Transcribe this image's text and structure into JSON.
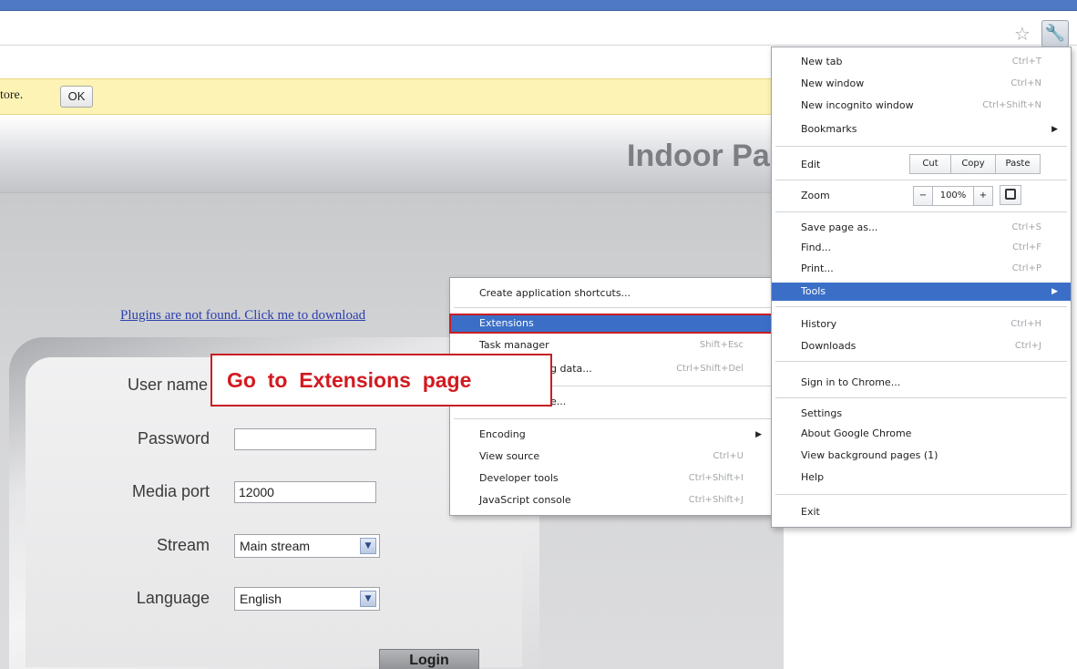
{
  "infobar": {
    "text": "tore.",
    "ok_label": "OK"
  },
  "page": {
    "title": "Indoor Pa",
    "plugin_link": "Plugins are not found. Click me to download"
  },
  "login": {
    "username_label": "User name",
    "password_label": "Password",
    "password_value": "",
    "media_port_label": "Media port",
    "media_port_value": "12000",
    "stream_label": "Stream",
    "stream_value": "Main stream",
    "language_label": "Language",
    "language_value": "English",
    "login_label": "Login"
  },
  "annotation": {
    "text": "Go  to  Extensions  page"
  },
  "toolbar": {
    "star_icon": "star-icon",
    "wrench_icon": "wrench-icon"
  },
  "main_menu": {
    "new_tab": "New tab",
    "new_tab_sc": "Ctrl+T",
    "new_window": "New window",
    "new_window_sc": "Ctrl+N",
    "new_incognito": "New incognito window",
    "new_incognito_sc": "Ctrl+Shift+N",
    "bookmarks": "Bookmarks",
    "edit": "Edit",
    "cut": "Cut",
    "copy": "Copy",
    "paste": "Paste",
    "zoom": "Zoom",
    "zoom_minus": "−",
    "zoom_value": "100%",
    "zoom_plus": "+",
    "save_page": "Save page as...",
    "save_page_sc": "Ctrl+S",
    "find": "Find...",
    "find_sc": "Ctrl+F",
    "print": "Print...",
    "print_sc": "Ctrl+P",
    "tools": "Tools",
    "history": "History",
    "history_sc": "Ctrl+H",
    "downloads": "Downloads",
    "downloads_sc": "Ctrl+J",
    "sign_in": "Sign in to Chrome...",
    "settings": "Settings",
    "about": "About Google Chrome",
    "background_pages": "View background pages (1)",
    "help": "Help",
    "exit": "Exit"
  },
  "tools_menu": {
    "create_shortcuts": "Create application shortcuts...",
    "extensions": "Extensions",
    "task_manager": "Task manager",
    "task_manager_sc": "Shift+Esc",
    "clear_data": "g data...",
    "clear_data_sc": "Ctrl+Shift+Del",
    "report_issue": "e...",
    "encoding": "Encoding",
    "view_source": "View source",
    "view_source_sc": "Ctrl+U",
    "developer_tools": "Developer tools",
    "developer_tools_sc": "Ctrl+Shift+I",
    "js_console": "JavaScript console",
    "js_console_sc": "Ctrl+Shift+J"
  },
  "colors": {
    "menu_highlight": "#3b6fc7",
    "annotation_red": "#d11a20",
    "infobar_bg": "#fdf3b4"
  }
}
